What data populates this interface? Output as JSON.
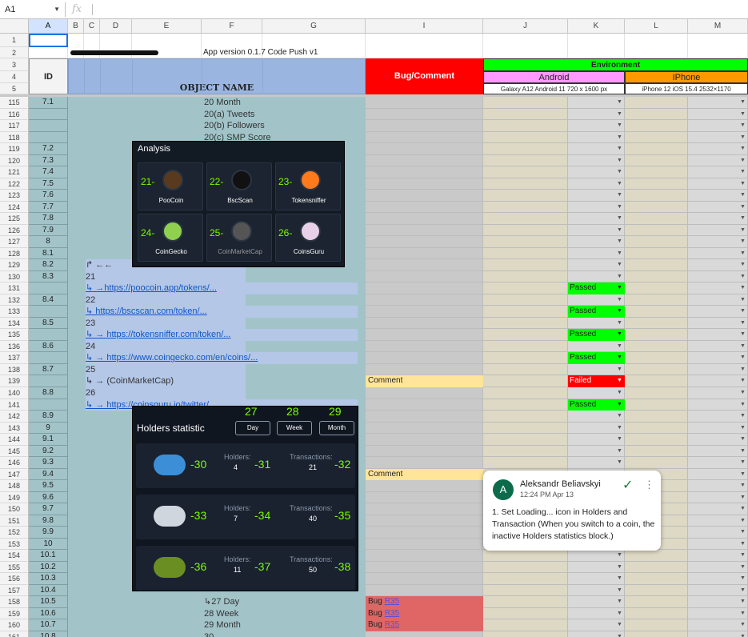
{
  "formula_bar": {
    "name_box": "A1",
    "fx": "fx"
  },
  "columns": [
    "A",
    "B",
    "C",
    "D",
    "E",
    "F",
    "G",
    "I",
    "J",
    "K",
    "L",
    "M"
  ],
  "header": {
    "app_version": "App version 0.1.7  Code Push v1",
    "id_label": "ID",
    "object_name_label": "OBJECT NAME",
    "bug_comment_label": "Bug/Comment",
    "environment_label": "Environment",
    "android_label": "Android",
    "iphone_label": "IPhone",
    "android_device": "Galaxy A12 Android 11 720 x 1600 px",
    "iphone_device": "iPhone 12 iOS 15.4 2532×1170"
  },
  "top_rows": [
    "1",
    "2",
    "3",
    "4",
    "5"
  ],
  "rows": [
    {
      "num": "115",
      "id": "7.1",
      "obj": "20 Month",
      "objcol": "F",
      "bug": "",
      "status": ""
    },
    {
      "num": "116",
      "id": "",
      "obj": "20(a) Tweets",
      "objcol": "F",
      "bug": "",
      "status": ""
    },
    {
      "num": "117",
      "id": "",
      "obj": "20(b) Followers",
      "objcol": "F",
      "bug": "",
      "status": ""
    },
    {
      "num": "118",
      "id": "",
      "obj": "20(c) SMP Score",
      "objcol": "F",
      "bug": "",
      "status": ""
    },
    {
      "num": "119",
      "id": "7.2",
      "obj": "",
      "bug": "",
      "status": ""
    },
    {
      "num": "120",
      "id": "7.3",
      "obj": "",
      "bug": "",
      "status": ""
    },
    {
      "num": "121",
      "id": "7.4",
      "obj": "",
      "bug": "",
      "status": ""
    },
    {
      "num": "122",
      "id": "7.5",
      "obj": "",
      "bug": "",
      "status": ""
    },
    {
      "num": "123",
      "id": "7.6",
      "obj": "",
      "bug": "",
      "status": ""
    },
    {
      "num": "124",
      "id": "7.7",
      "obj": "",
      "bug": "",
      "status": ""
    },
    {
      "num": "125",
      "id": "7.8",
      "obj": "",
      "bug": "",
      "status": ""
    },
    {
      "num": "126",
      "id": "7.9",
      "obj": "",
      "bug": "",
      "status": ""
    },
    {
      "num": "127",
      "id": "8",
      "obj": "",
      "bug": "",
      "status": ""
    },
    {
      "num": "128",
      "id": "8.1",
      "obj": "",
      "bug": "",
      "status": ""
    },
    {
      "num": "129",
      "id": "8.2",
      "obj": "↱ ←←",
      "objcol": "C",
      "bug": "",
      "status": ""
    },
    {
      "num": "130",
      "id": "8.3",
      "obj": "21",
      "objcol": "C",
      "bug": "",
      "status": ""
    },
    {
      "num": "131",
      "id": "",
      "obj": "↳ →https://poocoin.app/tokens/...",
      "objcol": "C",
      "link": true,
      "bug": "",
      "status": "Passed"
    },
    {
      "num": "132",
      "id": "8.4",
      "obj": "22",
      "objcol": "C",
      "bug": "",
      "status": ""
    },
    {
      "num": "133",
      "id": "",
      "obj": "↳ https://bscscan.com/token/...",
      "objcol": "C",
      "link": true,
      "bug": "",
      "status": "Passed"
    },
    {
      "num": "134",
      "id": "8.5",
      "obj": "23",
      "objcol": "C",
      "bug": "",
      "status": ""
    },
    {
      "num": "135",
      "id": "",
      "obj": "↳ → https://tokensniffer.com/token/...",
      "objcol": "C",
      "link": true,
      "bug": "",
      "status": "Passed"
    },
    {
      "num": "136",
      "id": "8.6",
      "obj": "24",
      "objcol": "C",
      "bug": "",
      "status": ""
    },
    {
      "num": "137",
      "id": "",
      "obj": "↳ → https://www.coingecko.com/en/coins/...",
      "objcol": "C",
      "link": true,
      "bug": "",
      "status": "Passed"
    },
    {
      "num": "138",
      "id": "8.7",
      "obj": "25",
      "objcol": "C",
      "bug": "",
      "status": ""
    },
    {
      "num": "139",
      "id": "",
      "obj": "↳ → (CoinMarketCap)",
      "objcol": "C",
      "bug": "Comment",
      "status": "Failed"
    },
    {
      "num": "140",
      "id": "8.8",
      "obj": "26",
      "objcol": "C",
      "bug": "",
      "status": ""
    },
    {
      "num": "141",
      "id": "",
      "obj": "↳ → https://coinsguru.io/twitter/...",
      "objcol": "C",
      "link": true,
      "bug": "",
      "status": "Passed"
    },
    {
      "num": "142",
      "id": "8.9",
      "obj": "",
      "bug": "",
      "status": ""
    },
    {
      "num": "143",
      "id": "9",
      "obj": "",
      "bug": "",
      "status": ""
    },
    {
      "num": "144",
      "id": "9.1",
      "obj": "",
      "bug": "",
      "status": ""
    },
    {
      "num": "145",
      "id": "9.2",
      "obj": "",
      "bug": "",
      "status": ""
    },
    {
      "num": "146",
      "id": "9.3",
      "obj": "",
      "bug": "",
      "status": ""
    },
    {
      "num": "147",
      "id": "9.4",
      "obj": "",
      "bug": "Comment",
      "status": ""
    },
    {
      "num": "148",
      "id": "9.5",
      "obj": "",
      "bug": "",
      "status": ""
    },
    {
      "num": "149",
      "id": "9.6",
      "obj": "",
      "bug": "",
      "status": ""
    },
    {
      "num": "150",
      "id": "9.7",
      "obj": "",
      "bug": "",
      "status": ""
    },
    {
      "num": "151",
      "id": "9.8",
      "obj": "",
      "bug": "",
      "status": ""
    },
    {
      "num": "152",
      "id": "9.9",
      "obj": "",
      "bug": "",
      "status": ""
    },
    {
      "num": "153",
      "id": "10",
      "obj": "",
      "bug": "",
      "status": ""
    },
    {
      "num": "154",
      "id": "10.1",
      "obj": "",
      "bug": "",
      "status": ""
    },
    {
      "num": "155",
      "id": "10.2",
      "obj": "",
      "bug": "",
      "status": ""
    },
    {
      "num": "156",
      "id": "10.3",
      "obj": "",
      "bug": "",
      "status": ""
    },
    {
      "num": "157",
      "id": "10.4",
      "obj": "",
      "bug": "",
      "status": ""
    },
    {
      "num": "158",
      "id": "10.5",
      "obj": "↳27 Day",
      "objcol": "F",
      "bug": "Bug",
      "buglink": "R35",
      "status": ""
    },
    {
      "num": "159",
      "id": "10.6",
      "obj": "28 Week",
      "objcol": "F",
      "bug": "Bug",
      "buglink": "R35",
      "status": ""
    },
    {
      "num": "160",
      "id": "10.7",
      "obj": "29 Month",
      "objcol": "F",
      "bug": "Bug",
      "buglink": "R35",
      "status": ""
    },
    {
      "num": "161",
      "id": "10.8",
      "obj": "30",
      "objcol": "F",
      "bug": "",
      "status": ""
    }
  ],
  "analysis_panel": {
    "title": "Analysis",
    "tiles": [
      {
        "num": "21-",
        "label": "PooCoin",
        "icon": "poocoin-icon"
      },
      {
        "num": "22-",
        "label": "BscScan",
        "icon": "bscscan-icon"
      },
      {
        "num": "23-",
        "label": "Tokensniffer",
        "icon": "tokensniffer-icon"
      },
      {
        "num": "24-",
        "label": "CoinGecko",
        "icon": "coingecko-icon"
      },
      {
        "num": "25-",
        "label": "CoinMarketCap",
        "icon": "coinmarketcap-icon"
      },
      {
        "num": "26-",
        "label": "CoinsGuru",
        "icon": "coinsguru-icon"
      }
    ]
  },
  "holders_panel": {
    "title": "Holders statistic",
    "marker_nums": [
      "27",
      "28",
      "29"
    ],
    "tabs": [
      "Day",
      "Week",
      "Month"
    ],
    "holders_label": "Holders:",
    "transactions_label": "Transactions:",
    "rows": [
      {
        "icon": "whale-icon",
        "n1": "-30",
        "holders": "4",
        "n2": "-31",
        "tx": "21",
        "n3": "-32"
      },
      {
        "icon": "shark-icon",
        "n1": "-33",
        "holders": "7",
        "n2": "-34",
        "tx": "40",
        "n3": "-35"
      },
      {
        "icon": "turtle-icon",
        "n1": "-36",
        "holders": "11",
        "n2": "-37",
        "tx": "50",
        "n3": "-38"
      }
    ]
  },
  "comment": {
    "avatar": "A",
    "author": "Aleksandr Beliavskyi",
    "time": "12:24 PM Apr 13",
    "text": "1. Set Loading... icon in Holders and Transaction (When you switch to a coin, the inactive Holders statistics block.)"
  },
  "colors": {
    "env_green": "#00ff00",
    "android_pink": "#ff99ff",
    "iphone_orange": "#ff9900",
    "bug_red": "#ff0000",
    "header_blue": "#9ab6e0",
    "teal_bg": "#a2c4c9",
    "passed": "#00ff00",
    "failed": "#ff0000",
    "comment_yellow": "#ffe599",
    "bug_row": "#e06666"
  }
}
